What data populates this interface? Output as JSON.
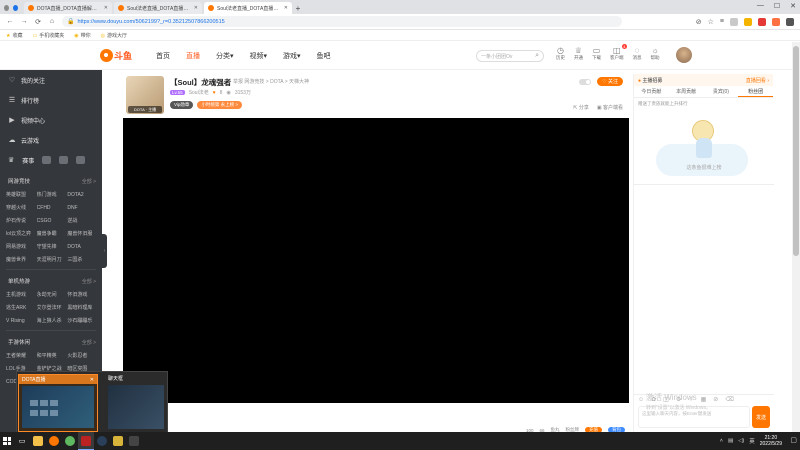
{
  "browser": {
    "tabs": [
      {
        "title": "DOTA直播_DOTA直播解说视",
        "active": false
      },
      {
        "title": "Soul法老直播_DOTA直播_斗",
        "active": false
      },
      {
        "title": "Soul法老直播_DOTA直播_斗",
        "active": true
      }
    ],
    "url": "https://www.douyu.com/5062199?_r=0.35212507866200515",
    "bookmarks": [
      "收藏",
      "手机收藏夹",
      "带你",
      "游戏大厅"
    ]
  },
  "site": {
    "logo_text": "斗鱼",
    "nav": [
      "首页",
      "直播",
      "分类",
      "视频",
      "游戏",
      "鱼吧"
    ],
    "search_placeholder": "一条小团团Ov",
    "header_icons": [
      {
        "icon": "clock-icon",
        "label": "历史"
      },
      {
        "icon": "crown-icon",
        "label": "开通"
      },
      {
        "icon": "folder-icon",
        "label": "下载"
      },
      {
        "icon": "bell-icon",
        "label": "客户端",
        "badge": "4"
      },
      {
        "icon": "chat-icon",
        "label": "消息"
      },
      {
        "icon": "bulb-icon",
        "label": "帮助"
      }
    ]
  },
  "sidebar": {
    "items": [
      {
        "icon": "heart-icon",
        "label": "我的关注"
      },
      {
        "icon": "rank-icon",
        "label": "排行榜"
      },
      {
        "icon": "video-icon",
        "label": "视频中心"
      },
      {
        "icon": "cloud-game-icon",
        "label": "云游戏"
      }
    ],
    "feature_label": "赛事",
    "categories": [
      {
        "title": "网游竞技",
        "more": "全部 >",
        "items": [
          "英雄联盟",
          "热门游戏",
          "DOTA2",
          "穿越火线",
          "CFHD",
          "DNF",
          "炉石传说",
          "CSGO",
          "逆战",
          "lol云顶之弈",
          "魔兽争霸",
          "魔兽怀旧服",
          "网易游戏",
          "守望先锋",
          "DOTA",
          "魔兽世界",
          "天涯明月刀",
          "三国杀"
        ]
      },
      {
        "title": "单机热游",
        "more": "全部 >",
        "items": [
          "主机游戏",
          "永劫无间",
          "怀旧游戏",
          "逃生ARK",
          "艾尔登法环",
          "黑暗料理库",
          "V Rising",
          "海上狼人杀",
          "沙石蹦蹦乐"
        ]
      },
      {
        "title": "手游休闲",
        "more": "全部 >",
        "items": [
          "王者荣耀",
          "和平精英",
          "火影忍者",
          "LOL手游",
          "金铲铲之战",
          "暗区突围",
          "COD"
        ]
      }
    ]
  },
  "room": {
    "title": "【Soul】龙魂强者",
    "report": "举报",
    "breadcrumb": "网游竞技 > DOTA > 天梯大神",
    "level": "Lv.55",
    "streamer": "Soul法老",
    "fans": "8",
    "hot": "3153万",
    "avatar_tag": "DOTA · 主播",
    "badge1": "Vip勋章",
    "badge2": "小时榜第 永上榜 >",
    "follow": "关注",
    "actions": [
      "分享",
      "客户端看"
    ]
  },
  "player_foot": {
    "gifts": [
      "100",
      "66",
      "鱼丸",
      "粉丝牌",
      "充值",
      "背包"
    ]
  },
  "rightpanel": {
    "top_left": "主播招募",
    "top_right": "直播回看",
    "tabs": [
      "今日贡献",
      "本周贡献",
      "贵宾(0)",
      "粉丝团"
    ],
    "note": "赠送了贵族就能上升排行",
    "empty": "这条鱼很难上榜",
    "input_placeholder": "这里输入聊天内容，按Enter键发送",
    "send": "发送"
  },
  "thumbnails": [
    {
      "title": "DOTA直播",
      "close": "✕"
    },
    {
      "title": "聊天框"
    }
  ],
  "watermark": {
    "line1": "激活 Windows",
    "line2": "转到“设置”以激活 Windows。"
  },
  "clock": {
    "time": "21:20",
    "date": "2022/5/29"
  },
  "tray": {
    "lang": "英"
  }
}
